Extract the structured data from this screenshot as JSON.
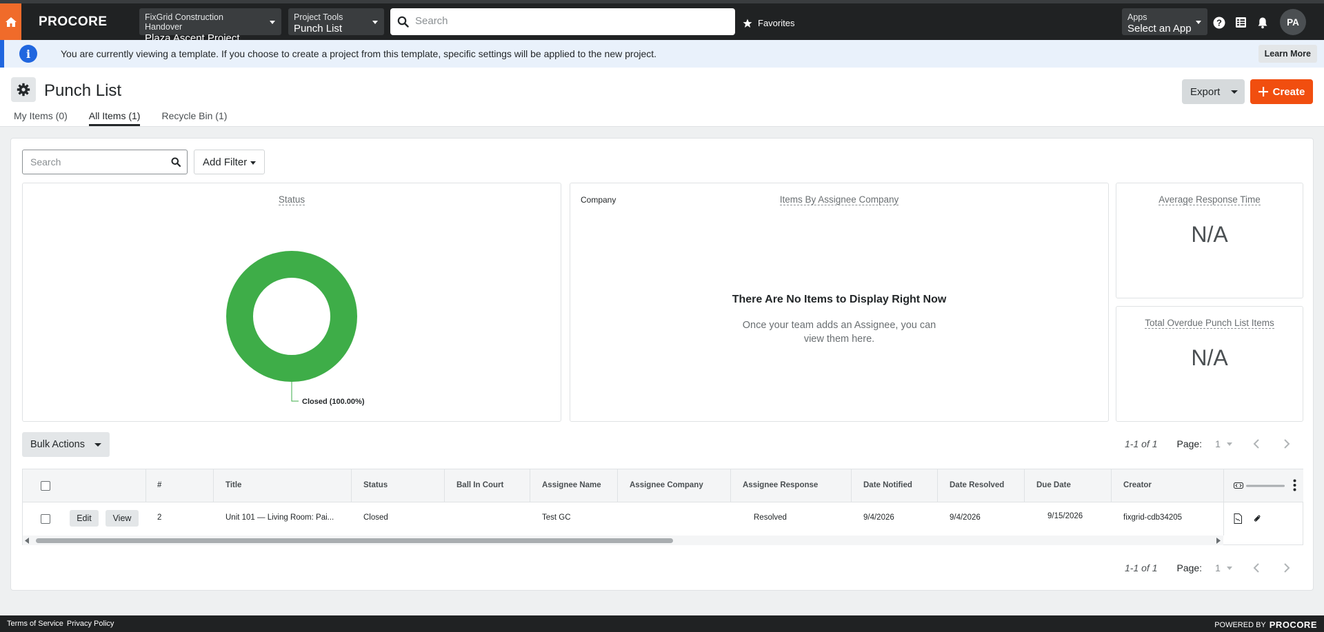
{
  "topbar": {
    "logo": "PROCORE",
    "project_selector": {
      "company": "FixGrid Construction Handover",
      "project": "Plaza Ascent Project"
    },
    "tool_selector": {
      "label": "Project Tools",
      "tool": "Punch List"
    },
    "search_placeholder": "Search",
    "favorites_label": "Favorites",
    "apps_selector": {
      "label": "Apps",
      "value": "Select an App"
    },
    "avatar_initials": "PA"
  },
  "banner": {
    "message": "You are currently viewing a template. If you choose to create a project from this template, specific settings will be applied to the new project.",
    "learn_more": "Learn More"
  },
  "header": {
    "title": "Punch List",
    "tabs": [
      {
        "label": "My Items (0)",
        "active": false
      },
      {
        "label": "All Items (1)",
        "active": true
      },
      {
        "label": "Recycle Bin (1)",
        "active": false
      }
    ],
    "export_label": "Export",
    "create_label": "Create"
  },
  "filters": {
    "search_placeholder": "Search",
    "add_filter_label": "Add Filter"
  },
  "cards": {
    "status": {
      "title": "Status",
      "chart_data": {
        "type": "pie",
        "categories": [
          "Closed"
        ],
        "values": [
          100.0
        ],
        "labels": [
          "Closed (100.00%)"
        ],
        "colors": [
          "#3ead48"
        ]
      }
    },
    "assignee": {
      "axis_label": "Company",
      "title": "Items By Assignee Company",
      "empty_title": "There Are No Items to Display Right Now",
      "empty_message": "Once your team adds an Assignee, you can view them here."
    },
    "avg_response": {
      "title": "Average Response Time",
      "value": "N/A"
    },
    "overdue": {
      "title": "Total Overdue Punch List Items",
      "value": "N/A"
    }
  },
  "bulk_actions_label": "Bulk Actions",
  "pagination": {
    "range": "1-1 of 1",
    "page_label": "Page:",
    "page_value": "1"
  },
  "table": {
    "columns": [
      "#",
      "Title",
      "Status",
      "Ball In Court",
      "Assignee Name",
      "Assignee Company",
      "Assignee Response",
      "Date Notified",
      "Date Resolved",
      "Due Date",
      "Creator"
    ],
    "rows": [
      {
        "edit_label": "Edit",
        "view_label": "View",
        "number": "2",
        "title": "Unit 101 — Living Room: Pai...",
        "status": "Closed",
        "ball_in_court": "",
        "assignee_name": "Test GC",
        "assignee_company": "",
        "assignee_response": "Resolved",
        "date_notified": "9/4/2026",
        "date_resolved": "9/4/2026",
        "due_date": "9/15/2026",
        "creator": "fixgrid-cdb34205"
      }
    ]
  },
  "footer": {
    "terms": "Terms of Service",
    "privacy": "Privacy Policy",
    "powered_by": "POWERED BY",
    "powered_logo": "PROCORE"
  },
  "colors": {
    "brand_orange": "#f14e0f",
    "topbar": "#202223",
    "info_blue": "#2066df",
    "chart_green": "#3ead48"
  }
}
